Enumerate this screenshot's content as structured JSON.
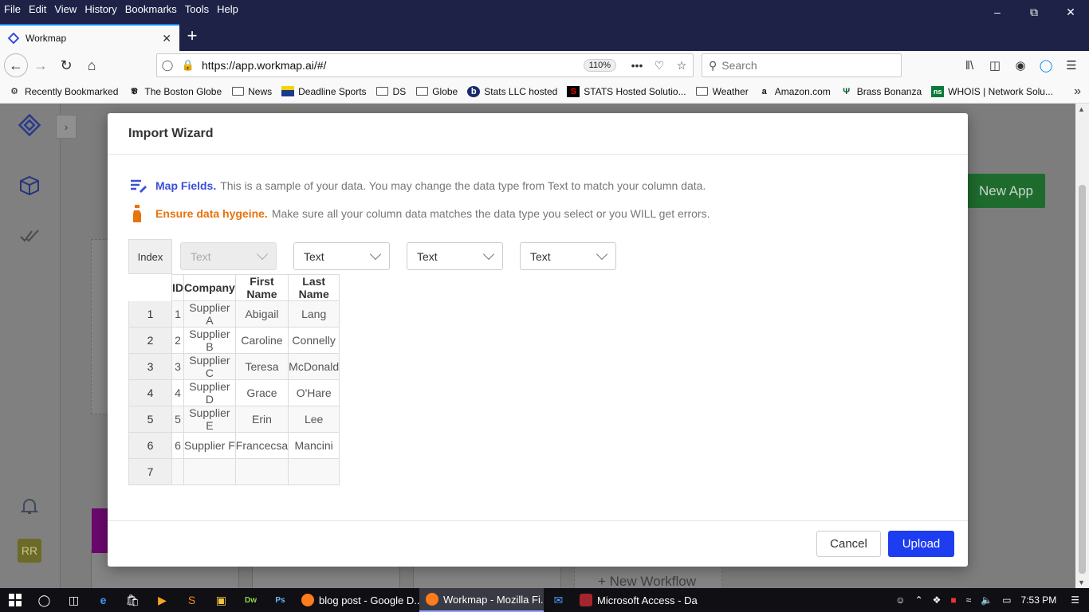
{
  "menu": [
    "File",
    "Edit",
    "View",
    "History",
    "Bookmarks",
    "Tools",
    "Help"
  ],
  "tab": {
    "title": "Workmap"
  },
  "nav": {
    "url": "https://app.workmap.ai/#/",
    "zoom": "110%",
    "search_placeholder": "Search"
  },
  "bookmarks": [
    {
      "label": "Recently Bookmarked",
      "icon": "gear-icon"
    },
    {
      "label": "The Boston Globe",
      "icon": "globe-logo-icon"
    },
    {
      "label": "News",
      "icon": "folder-icon"
    },
    {
      "label": "Deadline Sports",
      "icon": "site-icon"
    },
    {
      "label": "DS",
      "icon": "folder-icon"
    },
    {
      "label": "Globe",
      "icon": "folder-icon"
    },
    {
      "label": "Stats LLC hosted",
      "icon": "site-icon"
    },
    {
      "label": "STATS Hosted Solutio...",
      "icon": "site-icon"
    },
    {
      "label": "Weather",
      "icon": "folder-icon"
    },
    {
      "label": "Amazon.com",
      "icon": "amazon-icon"
    },
    {
      "label": "Brass Bonanza",
      "icon": "site-icon"
    },
    {
      "label": "WHOIS | Network Solu...",
      "icon": "site-icon"
    }
  ],
  "background": {
    "new_app_label": "New App",
    "new_workflow_label": "+ New Workflow",
    "avatar_initials": "RR"
  },
  "modal": {
    "title": "Import Wizard",
    "hint1_strong": "Map Fields.",
    "hint1_text": "This is a sample of your data. You may change the data type from Text to match your column data.",
    "hint2_strong": "Ensure data hygeine.",
    "hint2_text": "Make sure all your column data matches the data type you select or you WILL get errors.",
    "index_header": "Index",
    "type_dropdowns": [
      "Text",
      "Text",
      "Text",
      "Text"
    ],
    "columns": [
      "ID",
      "Company",
      "First Name",
      "Last Name"
    ],
    "index": [
      "1",
      "2",
      "3",
      "4",
      "5",
      "6",
      "7"
    ],
    "rows": [
      [
        "1",
        "Supplier A",
        "Abigail",
        "Lang"
      ],
      [
        "2",
        "Supplier B",
        "Caroline",
        "Connelly"
      ],
      [
        "3",
        "Supplier C",
        "Teresa",
        "McDonald"
      ],
      [
        "4",
        "Supplier D",
        "Grace",
        "O'Hare"
      ],
      [
        "5",
        "Supplier E",
        "Erin",
        "Lee"
      ],
      [
        "6",
        "Supplier F",
        "Francecsa",
        "Mancini"
      ],
      [
        "",
        "",
        "",
        ""
      ]
    ],
    "cancel_label": "Cancel",
    "upload_label": "Upload"
  },
  "taskbar": {
    "apps": [
      {
        "label": "blog post - Google D...",
        "active": false
      },
      {
        "label": "Workmap - Mozilla Fi...",
        "active": true
      },
      {
        "label": "Microsoft Access - Da...",
        "active": false
      }
    ],
    "time": "7:53 PM"
  },
  "colors": {
    "accent": "#1d3ef0",
    "hint_blue": "#3b4fd9",
    "hint_orange": "#e8720c",
    "new_app_green": "#1e6b2d"
  }
}
